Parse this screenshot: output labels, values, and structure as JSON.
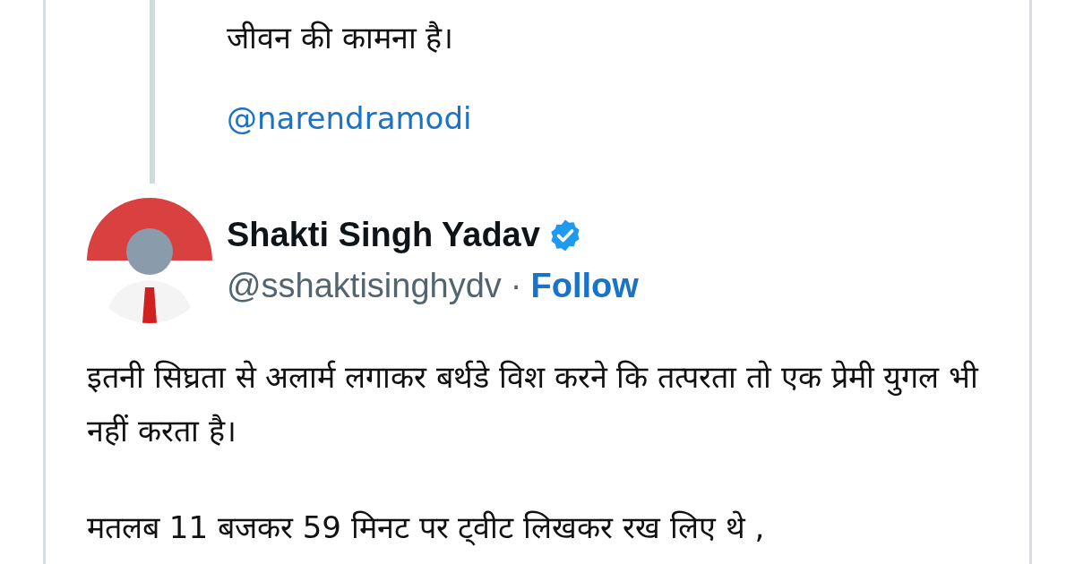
{
  "reply_context": {
    "text": "जीवन की कामना है।",
    "mention": "@narendramodi"
  },
  "author": {
    "name": "Shakti Singh Yadav",
    "verified": true,
    "handle": "@sshaktisinghydv",
    "separator": "·",
    "follow": "Follow"
  },
  "body": [
    "इतनी सिघ्रता से अलार्म लगाकर बर्थडे विश करने कि तत्परता तो एक प्रेमी युगल भी नहीं करता है।",
    "मतलब 11 बजकर 59 मिनट पर ट्वीट लिखकर रख लिए थे ,"
  ]
}
